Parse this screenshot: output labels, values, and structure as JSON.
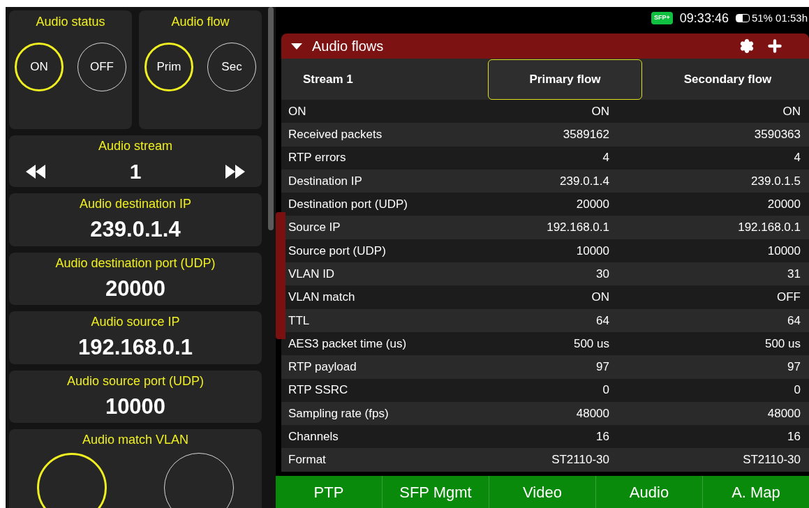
{
  "left_panel": {
    "toggles": [
      {
        "title": "Audio status",
        "options": [
          {
            "label": "ON",
            "selected": true
          },
          {
            "label": "OFF",
            "selected": false
          }
        ]
      },
      {
        "title": "Audio flow",
        "options": [
          {
            "label": "Prim",
            "selected": true
          },
          {
            "label": "Sec",
            "selected": false
          }
        ]
      }
    ],
    "stream": {
      "title": "Audio stream",
      "value": "1"
    },
    "fields": [
      {
        "title": "Audio destination IP",
        "value": "239.0.1.4"
      },
      {
        "title": "Audio destination port (UDP)",
        "value": "20000"
      },
      {
        "title": "Audio source IP",
        "value": "192.168.0.1"
      },
      {
        "title": "Audio source port (UDP)",
        "value": "10000"
      }
    ],
    "match_vlan": {
      "title": "Audio match VLAN",
      "options": [
        {
          "selected": true
        },
        {
          "selected": false
        }
      ]
    }
  },
  "status_bar": {
    "badge": "SFP+",
    "time": "09:33:46",
    "battery": "51% 01:53h"
  },
  "panel": {
    "title": "Audio flows",
    "expanded": true,
    "columns": [
      {
        "label": "Stream 1",
        "selected": false
      },
      {
        "label": "Primary flow",
        "selected": true
      },
      {
        "label": "Secondary flow",
        "selected": false
      }
    ],
    "rows": [
      [
        "ON",
        "ON",
        "ON"
      ],
      [
        "Received packets",
        "3589162",
        "3590363"
      ],
      [
        "RTP errors",
        "4",
        "4"
      ],
      [
        "Destination IP",
        "239.0.1.4",
        "239.0.1.5"
      ],
      [
        "Destination port (UDP)",
        "20000",
        "20000"
      ],
      [
        "Source IP",
        "192.168.0.1",
        "192.168.0.1"
      ],
      [
        "Source port (UDP)",
        "10000",
        "10000"
      ],
      [
        "VLAN ID",
        "30",
        "31"
      ],
      [
        "VLAN match",
        "ON",
        "OFF"
      ],
      [
        "TTL",
        "64",
        "64"
      ],
      [
        "AES3 packet time (us)",
        "500 us",
        "500 us"
      ],
      [
        "RTP payload",
        "97",
        "97"
      ],
      [
        "RTP SSRC",
        "0",
        "0"
      ],
      [
        "Sampling rate (fps)",
        "48000",
        "48000"
      ],
      [
        "Channels",
        "16",
        "16"
      ],
      [
        "Format",
        "ST2110-30",
        "ST2110-30"
      ]
    ]
  },
  "nav": [
    {
      "label": "PTP"
    },
    {
      "label": "SFP Mgmt"
    },
    {
      "label": "Video"
    },
    {
      "label": "Audio"
    },
    {
      "label": "A. Map"
    }
  ]
}
